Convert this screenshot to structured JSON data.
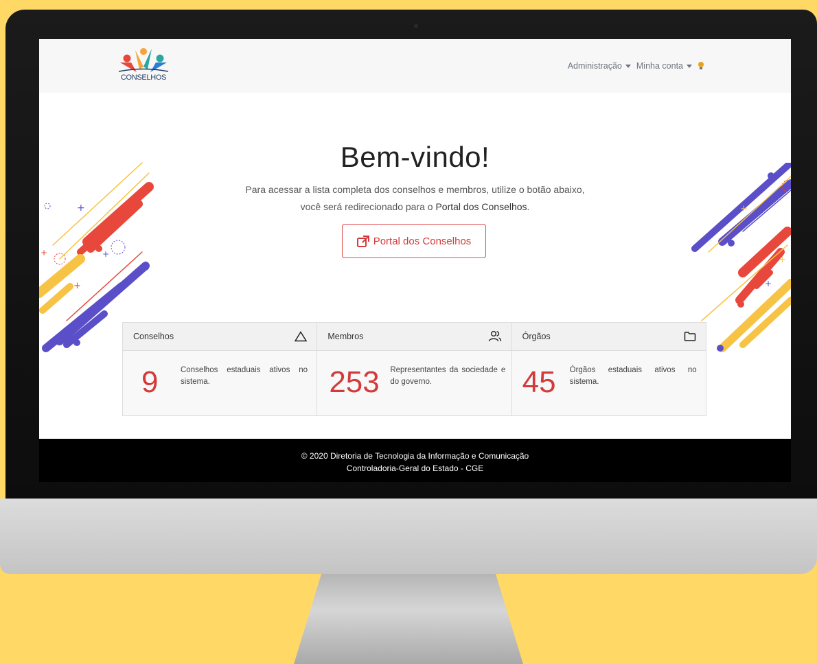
{
  "brand": {
    "logo_text": "CONSELHOS"
  },
  "nav": {
    "items": [
      {
        "label": "Administração"
      },
      {
        "label": "Minha conta"
      }
    ]
  },
  "hero": {
    "title": "Bem-vindo!",
    "line1": "Para acessar a lista completa dos conselhos e membros, utilize o botão abaixo,",
    "line2_prefix": "você será redirecionado para o ",
    "line2_link": "Portal dos Conselhos",
    "line2_suffix": ".",
    "button_label": "Portal dos Conselhos"
  },
  "cards": [
    {
      "title": "Conselhos",
      "icon": "triangle-icon",
      "value": "9",
      "description": "Conselhos estaduais ativos no sistema."
    },
    {
      "title": "Membros",
      "icon": "users-icon",
      "value": "253",
      "description": "Representantes da sociedade e do governo."
    },
    {
      "title": "Órgãos",
      "icon": "folder-icon",
      "value": "45",
      "description": "Órgãos estaduais ativos no sistema."
    }
  ],
  "footer": {
    "line1": "© 2020 Diretoria de Tecnologia da Informação e Comunicação",
    "line2": "Controladoria-Geral do Estado - CGE"
  },
  "colors": {
    "accent": "#d33b3b",
    "background": "#ffd866",
    "deco_red": "#e8473c",
    "deco_blue": "#5a4fc9",
    "deco_yellow": "#f6c344"
  }
}
